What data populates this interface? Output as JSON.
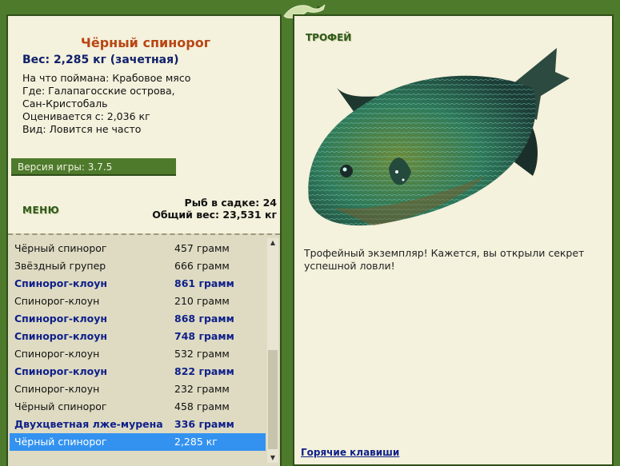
{
  "fish_card": {
    "name": "Чёрный спинорог",
    "weight": "Вес: 2,285 кг (зачетная)",
    "bait": "На что поймана: Крабовое мясо",
    "where_1": "Где: Галапагосские острова,",
    "where_2": "Сан-Кристобаль",
    "estimate": "Оценивается с: 2,036 кг",
    "kind": "Вид: Ловится не часто"
  },
  "version": "Версия игры: 3.7.5",
  "menu_label": "МЕНЮ",
  "keepnet": {
    "count": "Рыб в садке: 24",
    "total": "Общий вес: 23,531 кг"
  },
  "catch_list": [
    {
      "name": "Чёрный спинорог",
      "weight": "457 грамм",
      "bold": false,
      "selected": false
    },
    {
      "name": "Звёздный групер",
      "weight": "666 грамм",
      "bold": false,
      "selected": false
    },
    {
      "name": "Спинорог-клоун",
      "weight": "861 грамм",
      "bold": true,
      "selected": false
    },
    {
      "name": "Спинорог-клоун",
      "weight": "210 грамм",
      "bold": false,
      "selected": false
    },
    {
      "name": "Спинорог-клоун",
      "weight": "868 грамм",
      "bold": true,
      "selected": false
    },
    {
      "name": "Спинорог-клоун",
      "weight": "748 грамм",
      "bold": true,
      "selected": false
    },
    {
      "name": "Спинорог-клоун",
      "weight": "532 грамм",
      "bold": false,
      "selected": false
    },
    {
      "name": "Спинорог-клоун",
      "weight": "822 грамм",
      "bold": true,
      "selected": false
    },
    {
      "name": "Спинорог-клоун",
      "weight": "232 грамм",
      "bold": false,
      "selected": false
    },
    {
      "name": "Чёрный спинорог",
      "weight": "458 грамм",
      "bold": false,
      "selected": false
    },
    {
      "name": "Двухцветная лже-мурена",
      "weight": "336 грамм",
      "bold": true,
      "selected": false
    },
    {
      "name": "Чёрный спинорог",
      "weight": "2,285 кг",
      "bold": false,
      "selected": true
    }
  ],
  "trophy": {
    "label": "ТРОФЕЙ",
    "text": "Трофейный экземпляр! Кажется, вы открыли секрет успешной ловли!"
  },
  "hotkeys": "Горячие клавиши",
  "colors": {
    "frame_green": "#4e7a2c",
    "panel_bg": "#f4f1dc",
    "title_orange": "#b84614",
    "link_blue": "#10208a",
    "selection": "#3392f0"
  }
}
